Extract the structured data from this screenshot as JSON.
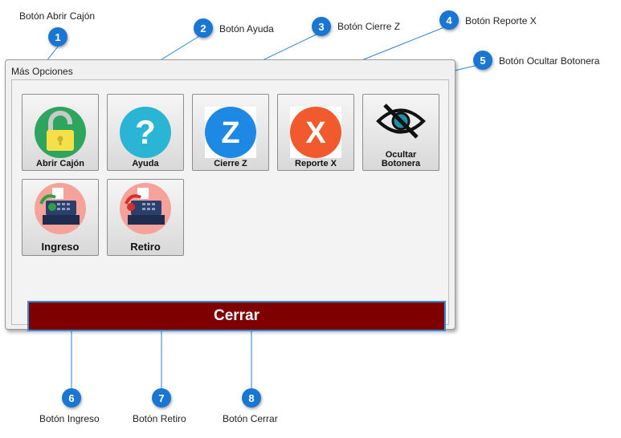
{
  "dialog": {
    "title": "Más Opciones",
    "buttons": {
      "abrir_cajon": "Abrir Cajón",
      "ayuda": "Ayuda",
      "cierre_z": "Cierre Z",
      "reporte_x": "Reporte X",
      "ocultar_line1": "Ocultar",
      "ocultar_line2": "Botonera",
      "ingreso": "Ingreso",
      "retiro": "Retiro",
      "cerrar": "Cerrar"
    },
    "icons": {
      "abrir_cajon": "unlocked-padlock-icon",
      "ayuda": "question-mark-icon",
      "cierre_z": "letter-z-icon",
      "reporte_x": "letter-x-icon",
      "ocultar": "eye-slash-icon",
      "ingreso": "cash-register-in-icon",
      "retiro": "cash-register-out-icon"
    },
    "colors": {
      "cerrar_bg": "#7f0000",
      "ayuda_circle": "#2bb5d5",
      "cierre_z_circle": "#1e88e5",
      "reporte_x_circle": "#f05a2c",
      "abrir_cajon_circle": "#2ea55f"
    }
  },
  "callouts": [
    {
      "number": "1",
      "label": "Botón Abrir Cajón"
    },
    {
      "number": "2",
      "label": "Botón Ayuda"
    },
    {
      "number": "3",
      "label": "Botón Cierre Z"
    },
    {
      "number": "4",
      "label": "Botón Reporte X"
    },
    {
      "number": "5",
      "label": "Botón Ocultar Botonera"
    },
    {
      "number": "6",
      "label": "Botón Ingreso"
    },
    {
      "number": "7",
      "label": "Botón Retiro"
    },
    {
      "number": "8",
      "label": "Botón Cerrar"
    }
  ]
}
